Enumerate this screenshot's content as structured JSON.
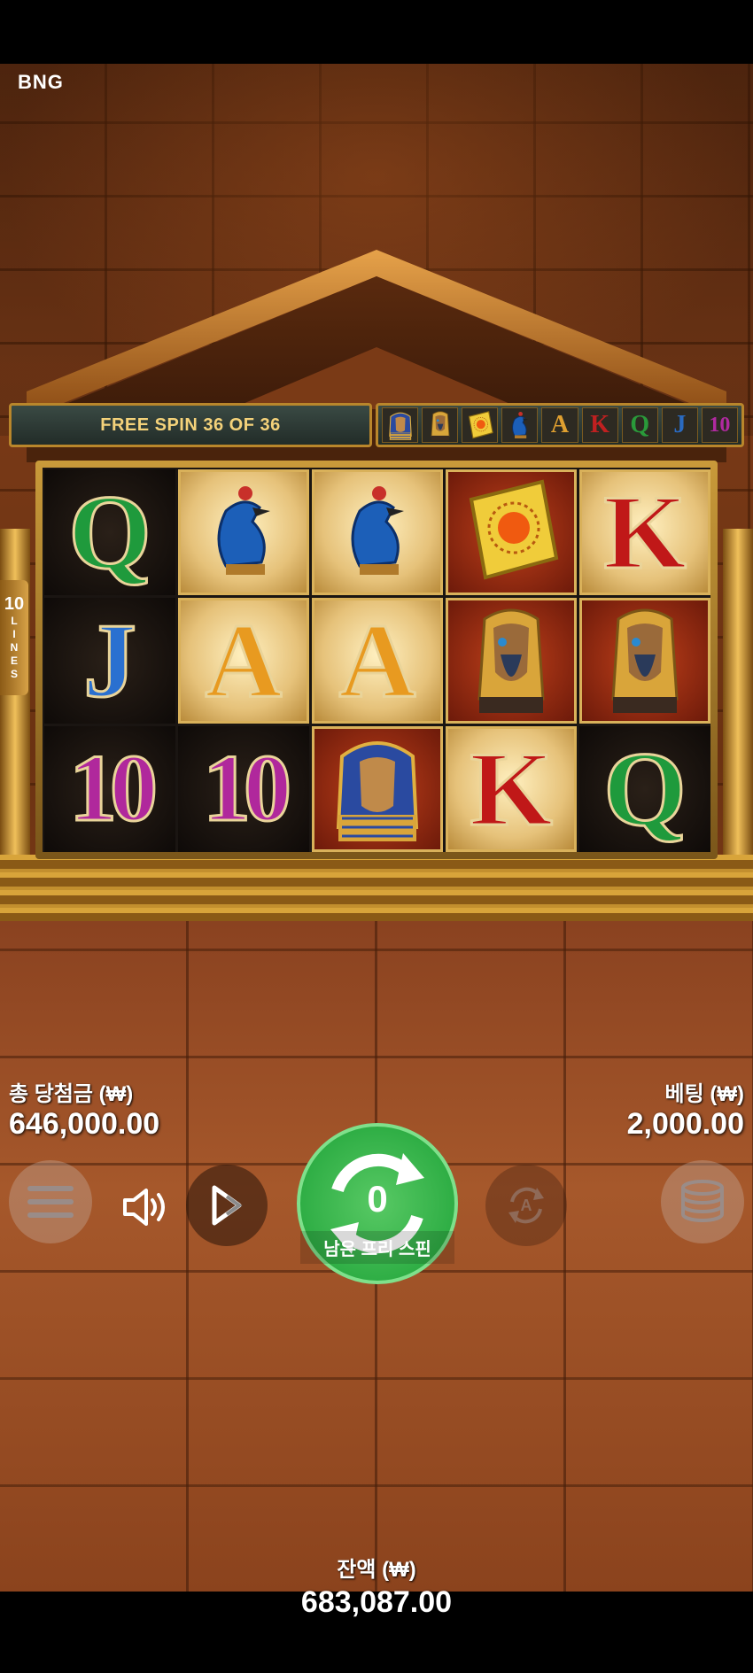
{
  "brand": "BNG",
  "free_spin_banner": "FREE SPIN 36 OF 36",
  "paytable_symbols": [
    {
      "icon": "pharaoh-icon"
    },
    {
      "icon": "horus-icon"
    },
    {
      "icon": "scarab-icon"
    },
    {
      "icon": "falcon-icon"
    },
    {
      "label": "A",
      "color": "#e0a030"
    },
    {
      "label": "K",
      "color": "#c02020"
    },
    {
      "label": "Q",
      "color": "#2a9a3a"
    },
    {
      "label": "J",
      "color": "#2a6ac0"
    },
    {
      "label": "10",
      "color": "#b02aa0"
    }
  ],
  "lines": {
    "count": "10",
    "word": "LINES"
  },
  "reels": [
    [
      {
        "sym": "Q",
        "bg": "dark",
        "color": "#1f9a3c"
      },
      {
        "sym": "falcon",
        "bg": "gold"
      },
      {
        "sym": "falcon",
        "bg": "gold"
      },
      {
        "sym": "book",
        "bg": "red"
      },
      {
        "sym": "K",
        "bg": "gold",
        "color": "#c01818"
      }
    ],
    [
      {
        "sym": "J",
        "bg": "dark",
        "color": "#2a70d0"
      },
      {
        "sym": "A",
        "bg": "gold",
        "color": "#e89a20"
      },
      {
        "sym": "A",
        "bg": "gold",
        "color": "#e89a20"
      },
      {
        "sym": "horus",
        "bg": "red"
      },
      {
        "sym": "horus",
        "bg": "red"
      }
    ],
    [
      {
        "sym": "10",
        "bg": "dark",
        "color": "#b0289c"
      },
      {
        "sym": "10",
        "bg": "dark",
        "color": "#b0289c"
      },
      {
        "sym": "pharaoh",
        "bg": "red"
      },
      {
        "sym": "K",
        "bg": "gold",
        "color": "#c01818"
      },
      {
        "sym": "Q",
        "bg": "dark",
        "color": "#1f9a3c"
      }
    ]
  ],
  "total_win": {
    "label": "총 당첨금 (₩)",
    "value": "646,000.00"
  },
  "bet": {
    "label": "베팅 (₩)",
    "value": "2,000.00"
  },
  "spin": {
    "count": "0",
    "label": "남은 프리 스핀"
  },
  "balance": {
    "label": "잔액 (₩)",
    "value": "683,087.00"
  },
  "controls": {
    "menu_icon": "hamburger-menu-icon",
    "sound_icon": "speaker-icon",
    "turbo_icon": "play-fast-icon",
    "autoplay_icon": "autoplay-icon",
    "coins_icon": "coin-stack-icon"
  }
}
